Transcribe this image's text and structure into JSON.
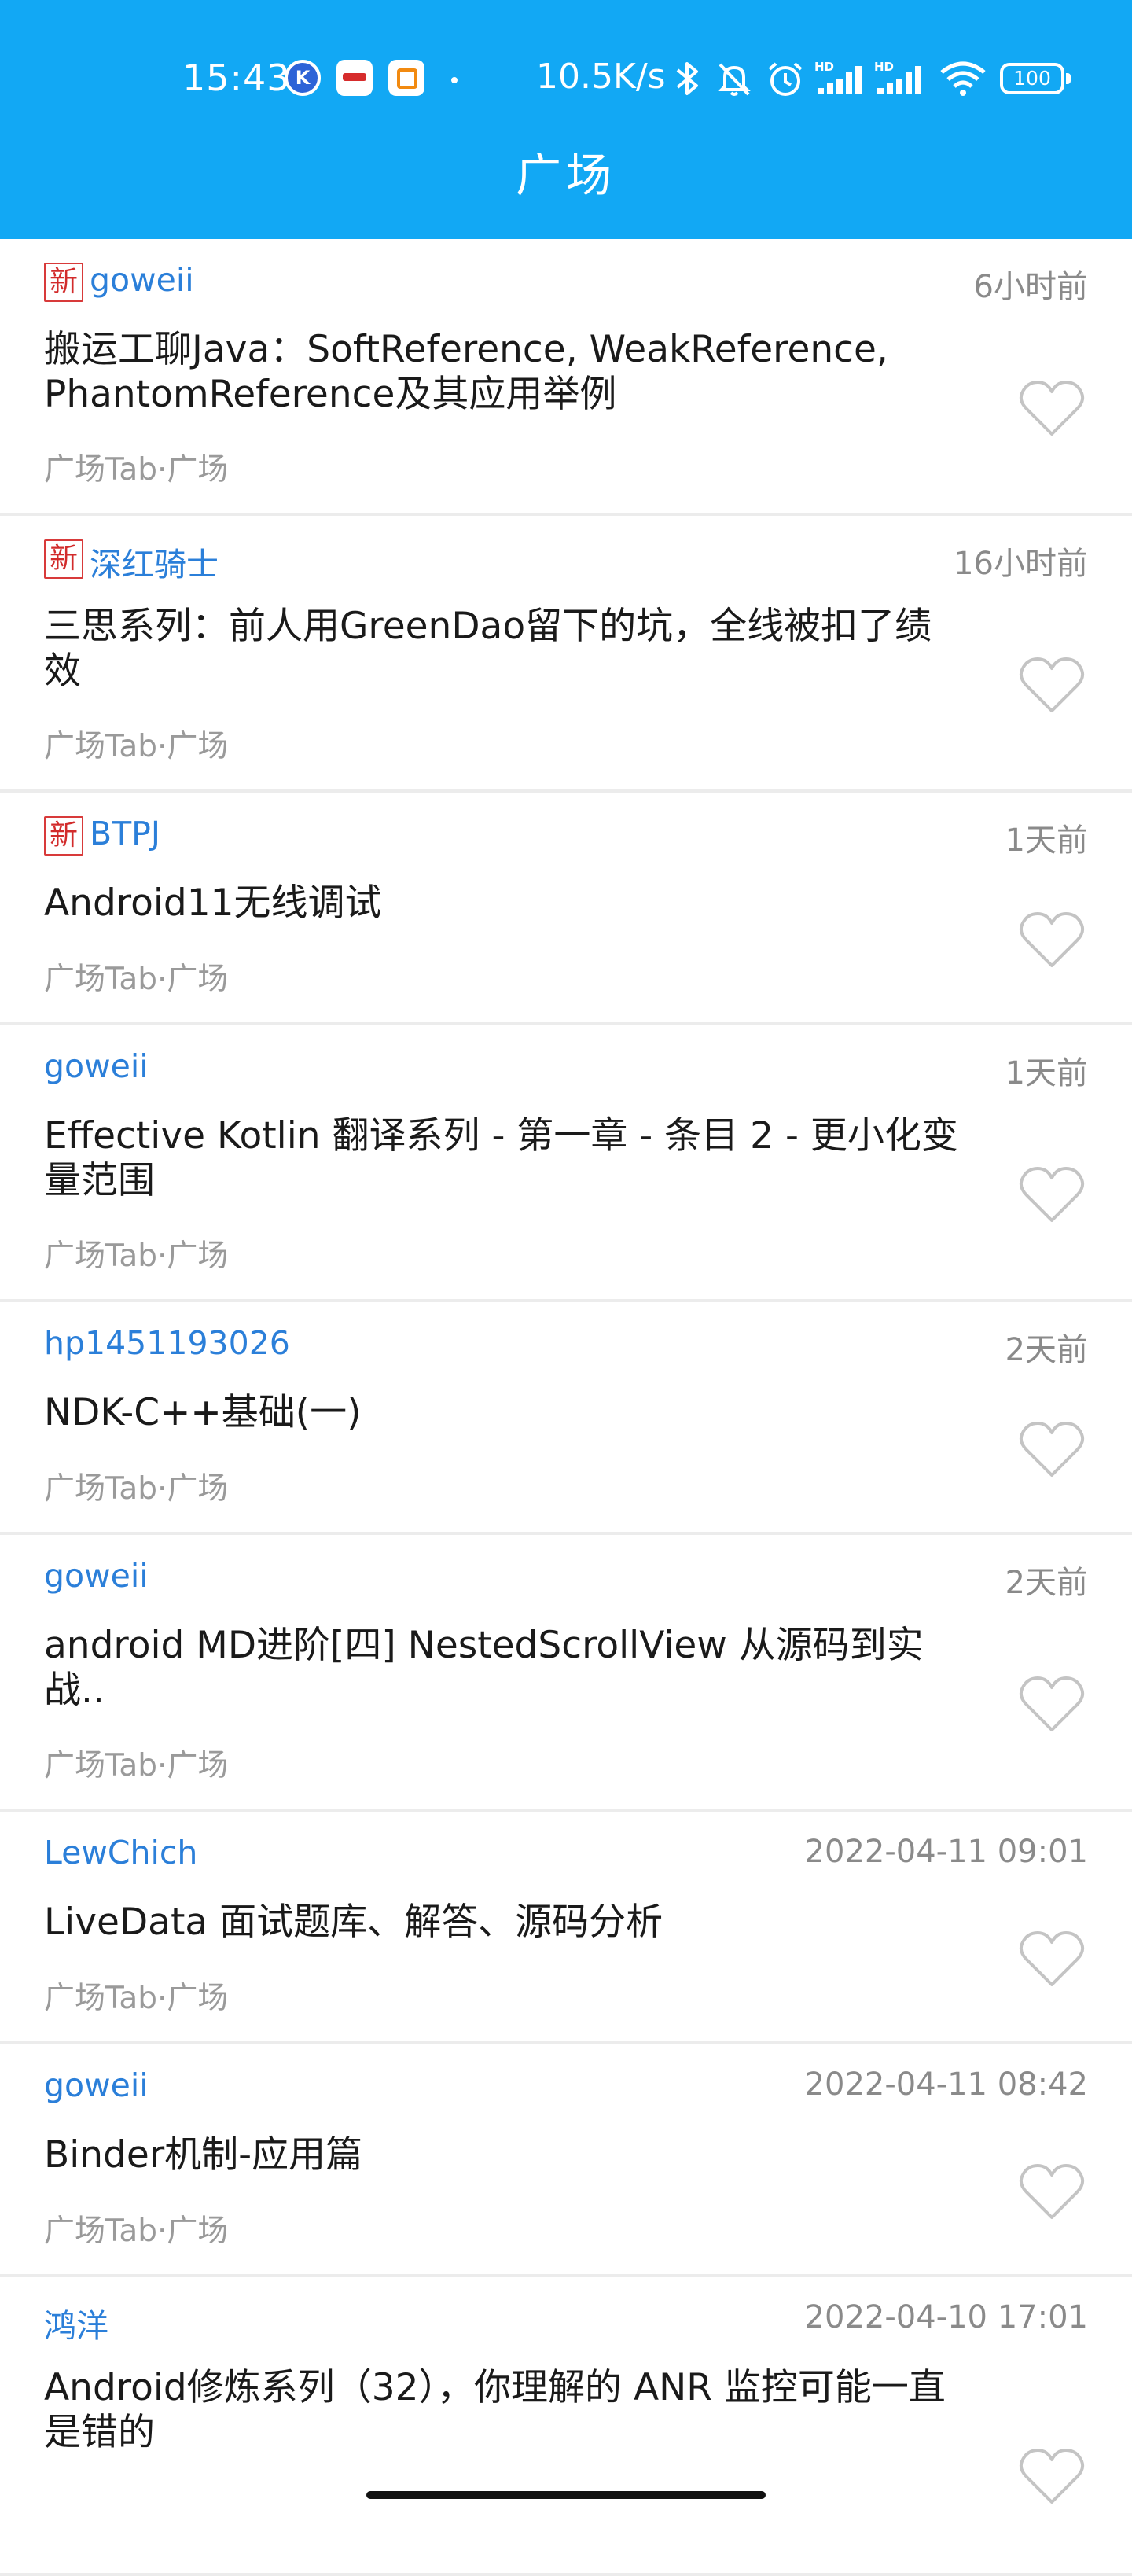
{
  "status_bar": {
    "time": "15:43",
    "net_speed": "10.5K/s",
    "battery": "100",
    "icons": [
      "k-app-icon",
      "news-app-icon",
      "square-app-icon",
      "bluetooth-icon",
      "mute-icon",
      "alarm-icon",
      "hd-signal-icon",
      "hd-signal-icon",
      "wifi-icon",
      "battery-icon"
    ]
  },
  "app_bar": {
    "title": "广场"
  },
  "colors": {
    "primary": "#12a8f4",
    "author": "#2b7fd9",
    "new_badge": "#d22b2b"
  },
  "new_label": "新",
  "articles": [
    {
      "is_new": true,
      "author": "goweii",
      "time": "6小时前",
      "title": "搬运工聊Java：SoftReference, WeakReference, PhantomReference及其应用举例",
      "meta": "广场Tab·广场"
    },
    {
      "is_new": true,
      "author": "深红骑士",
      "time": "16小时前",
      "title": "三思系列：前人用GreenDao留下的坑，全线被扣了绩效",
      "meta": "广场Tab·广场"
    },
    {
      "is_new": true,
      "author": "BTPJ",
      "time": "1天前",
      "title": "Android11无线调试",
      "meta": "广场Tab·广场"
    },
    {
      "is_new": false,
      "author": "goweii",
      "time": "1天前",
      "title": "Effective Kotlin 翻译系列 - 第一章 - 条目 2 - 更小化变量范围",
      "meta": "广场Tab·广场"
    },
    {
      "is_new": false,
      "author": "hp1451193026",
      "time": "2天前",
      "title": "NDK-C++基础(一)",
      "meta": "广场Tab·广场"
    },
    {
      "is_new": false,
      "author": "goweii",
      "time": "2天前",
      "title": "android MD进阶[四] NestedScrollView 从源码到实战..",
      "meta": "广场Tab·广场"
    },
    {
      "is_new": false,
      "author": "LewChich",
      "time": "2022-04-11 09:01",
      "title": "LiveData 面试题库、解答、源码分析",
      "meta": "广场Tab·广场"
    },
    {
      "is_new": false,
      "author": "goweii",
      "time": "2022-04-11 08:42",
      "title": "Binder机制-应用篇",
      "meta": "广场Tab·广场"
    },
    {
      "is_new": false,
      "author": "鸿洋",
      "time": "2022-04-10 17:01",
      "title": "Android修炼系列（32），你理解的 ANR 监控可能一直是错的",
      "meta": ""
    }
  ]
}
